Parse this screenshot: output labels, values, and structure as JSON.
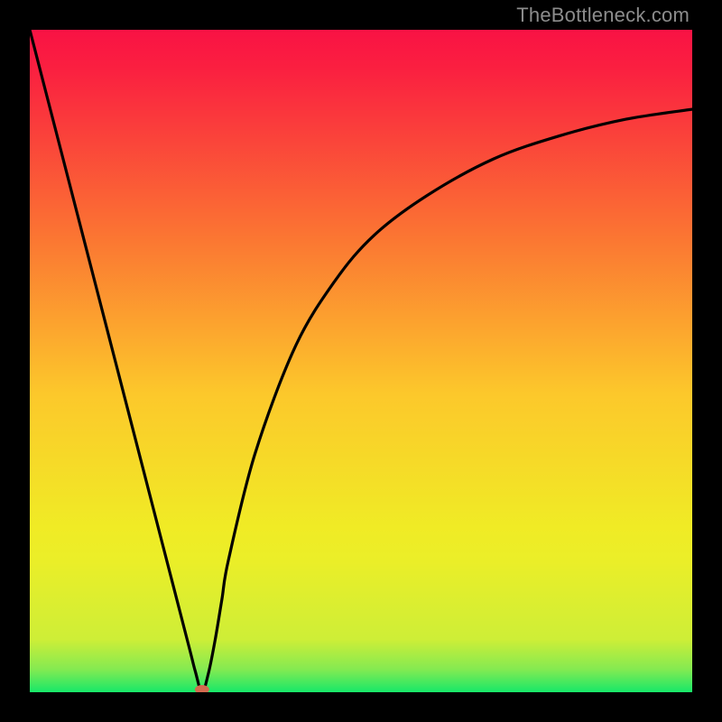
{
  "watermark": "TheBottleneck.com",
  "chart_data": {
    "type": "line",
    "title": "",
    "xlabel": "",
    "ylabel": "",
    "xlim": [
      0,
      100
    ],
    "ylim": [
      0,
      100
    ],
    "legend": false,
    "grid": false,
    "background_gradient": {
      "top_color": "#f91244",
      "mid_color": "#fcc82b",
      "bottom_color": "#17e869"
    },
    "series": [
      {
        "name": "bottleneck-curve",
        "color": "#000000",
        "x": [
          0,
          4,
          8,
          12,
          16,
          20,
          24,
          25,
          26,
          27,
          28,
          29,
          30,
          34,
          40,
          46,
          52,
          60,
          70,
          80,
          90,
          100
        ],
        "y": [
          100,
          84.5,
          69,
          53.5,
          38,
          22.5,
          7,
          3.1,
          0,
          3,
          8,
          14,
          20,
          36,
          52,
          62,
          69,
          75,
          80.5,
          84,
          86.5,
          88
        ]
      }
    ],
    "marker": {
      "name": "minimum-marker",
      "x": 26,
      "y": 0,
      "color": "#d46a4f",
      "rx": 8,
      "ry": 5
    }
  }
}
